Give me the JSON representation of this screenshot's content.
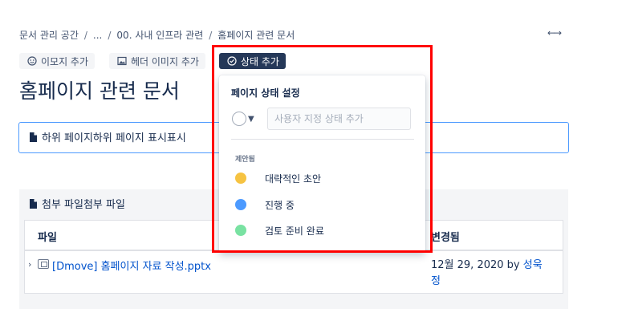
{
  "breadcrumb": {
    "items": [
      "문서 관리 공간",
      "...",
      "00. 사내 인프라 관련",
      "홈페이지 관련 문서"
    ],
    "separator": "/"
  },
  "toolbar": {
    "emoji_label": "이모지 추가",
    "header_image_label": "헤더 이미지 추가",
    "status_label": "상태 추가"
  },
  "page": {
    "title": "홈페이지 관련 문서"
  },
  "children_panel": {
    "label": "하위 페이지하위 페이지 표시표시"
  },
  "attachments": {
    "heading": "첨부 파일첨부 파일",
    "columns": {
      "file": "파일",
      "modified": "변경됨"
    },
    "rows": [
      {
        "file_name": "[Dmove] 홈페이지 자료 작성.pptx",
        "modified_date": "12월 29, 2020 by ",
        "modified_by": "성욱정"
      }
    ]
  },
  "status_popup": {
    "title": "페이지 상태 설정",
    "input_placeholder": "사용자 지정 상태 추가",
    "section_label": "제안됨",
    "options": [
      {
        "label": "대략적인 초안",
        "color": "#F6C342"
      },
      {
        "label": "진행 중",
        "color": "#4C9AFF"
      },
      {
        "label": "검토 준비 완료",
        "color": "#79E2A2"
      }
    ]
  },
  "colors": {
    "highlight": "#FF0000",
    "link": "#0052CC",
    "status_button_bg": "#253858"
  }
}
